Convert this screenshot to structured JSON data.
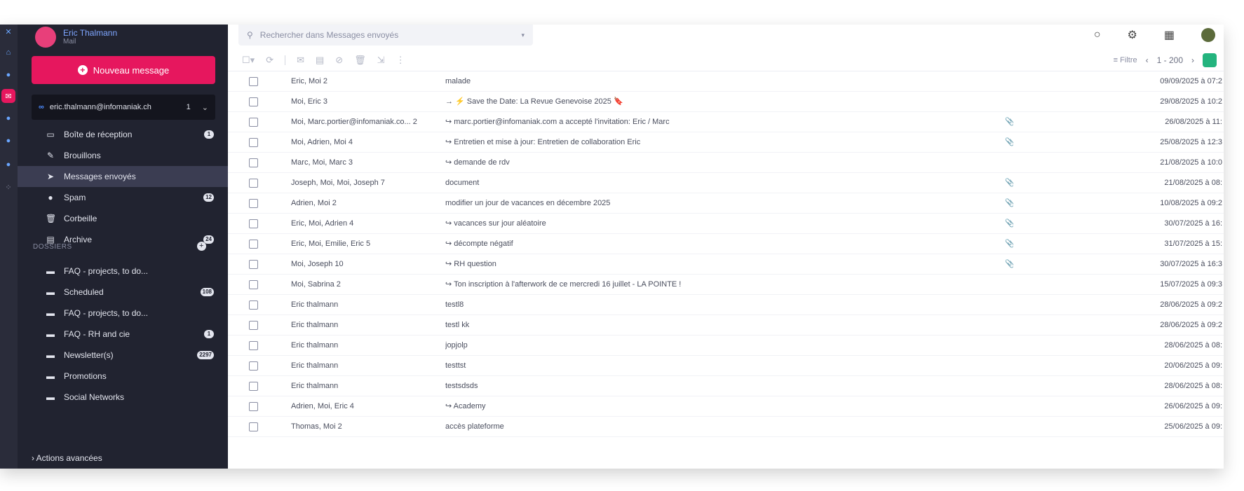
{
  "account": {
    "name": "Eric Thalmann",
    "subtitle": "Mail"
  },
  "sidebar": {
    "new_message_label": "Nouveau message",
    "mailbox_address": "eric.thalmann@infomaniak.ch",
    "mailbox_count": "1",
    "folders": [
      {
        "label": "Boîte de réception",
        "icon": "inbox-icon",
        "glyph": "▭",
        "badge": "1"
      },
      {
        "label": "Brouillons",
        "icon": "drafts-icon",
        "glyph": "✎",
        "badge": ""
      },
      {
        "label": "Messages envoyés",
        "icon": "sent-icon",
        "glyph": "➤",
        "badge": ""
      },
      {
        "label": "Spam",
        "icon": "spam-icon",
        "glyph": "●",
        "badge": "12"
      },
      {
        "label": "Corbeille",
        "icon": "trash-icon",
        "glyph": "🗑",
        "badge": ""
      },
      {
        "label": "Archive",
        "icon": "archive-icon",
        "glyph": "▤",
        "badge": "24"
      }
    ],
    "dossiers_label": "DOSSIERS",
    "dossiers": [
      {
        "label": "FAQ - projects, to do...",
        "badge": ""
      },
      {
        "label": "Scheduled",
        "badge": "108"
      },
      {
        "label": "FAQ - projects, to do...",
        "badge": ""
      },
      {
        "label": "FAQ - RH and cie",
        "badge": "1"
      },
      {
        "label": "Newsletter(s)",
        "badge": "2297"
      },
      {
        "label": "Promotions",
        "badge": ""
      },
      {
        "label": "Social Networks",
        "badge": ""
      }
    ],
    "more_actions_label": "Actions avancées"
  },
  "search": {
    "placeholder": "Rechercher dans Messages envoyés"
  },
  "toolbar": {
    "filter_label": "Filtre",
    "page": "1",
    "page_total": "200"
  },
  "emails": [
    {
      "from": "Eric, Moi 2",
      "subject": "malade",
      "att": "",
      "date": "09/09/2025 à 07:2"
    },
    {
      "from": "Moi, Eric 3",
      "subject": "→ ⚡ Save the Date: La Revue Genevoise 2025 🔖",
      "att": "",
      "date": "29/08/2025 à 10:2"
    },
    {
      "from": "Moi, Marc.portier@infomaniak.co... 2",
      "subject": "↪ marc.portier@infomaniak.com a accepté l'invitation: Eric / Marc",
      "att": "📎",
      "date": "26/08/2025 à 11:"
    },
    {
      "from": "Moi, Adrien, Moi 4",
      "subject": "↪ Entretien et mise à jour: Entretien de collaboration Eric",
      "att": "📎",
      "date": "25/08/2025 à 12:3"
    },
    {
      "from": "Marc, Moi, Marc 3",
      "subject": "↪ demande de rdv",
      "att": "",
      "date": "21/08/2025 à 10:0"
    },
    {
      "from": "Joseph, Moi, Moi, Joseph 7",
      "subject": "document",
      "att": "📎",
      "date": "21/08/2025 à 08:"
    },
    {
      "from": "Adrien, Moi 2",
      "subject": "modifier un jour de vacances en décembre 2025",
      "att": "📎",
      "date": "10/08/2025 à 09:2"
    },
    {
      "from": "Eric, Moi, Adrien 4",
      "subject": "↪ vacances sur jour aléatoire",
      "att": "📎",
      "date": "30/07/2025 à 16:"
    },
    {
      "from": "Eric, Moi, Emilie, Eric 5",
      "subject": "↪ décompte négatif",
      "att": "📎",
      "date": "31/07/2025 à 15:"
    },
    {
      "from": "Moi, Joseph 10",
      "subject": "↪ RH question",
      "att": "📎",
      "date": "30/07/2025 à 16:3"
    },
    {
      "from": "Moi, Sabrina 2",
      "subject": "↪ Ton inscription à l'afterwork de ce mercredi 16 juillet - LA POINTE !",
      "att": "",
      "date": "15/07/2025 à 09:3"
    },
    {
      "from": "Eric thalmann",
      "subject": "testl8",
      "att": "",
      "date": "28/06/2025 à 09:2"
    },
    {
      "from": "Eric thalmann",
      "subject": "testl kk",
      "att": "",
      "date": "28/06/2025 à 09:2"
    },
    {
      "from": "Eric thalmann",
      "subject": "jopjolp",
      "att": "",
      "date": "28/06/2025 à 08:"
    },
    {
      "from": "Eric thalmann",
      "subject": "testtst",
      "att": "",
      "date": "20/06/2025 à 09:"
    },
    {
      "from": "Eric thalmann",
      "subject": "testsdsds",
      "att": "",
      "date": "28/06/2025 à 08:"
    },
    {
      "from": "Adrien, Moi, Eric 4",
      "subject": "↪ Academy",
      "att": "",
      "date": "26/06/2025 à 09:"
    },
    {
      "from": "Thomas, Moi 2",
      "subject": "accès plateforme",
      "att": "",
      "date": "25/06/2025 à 09:"
    }
  ]
}
